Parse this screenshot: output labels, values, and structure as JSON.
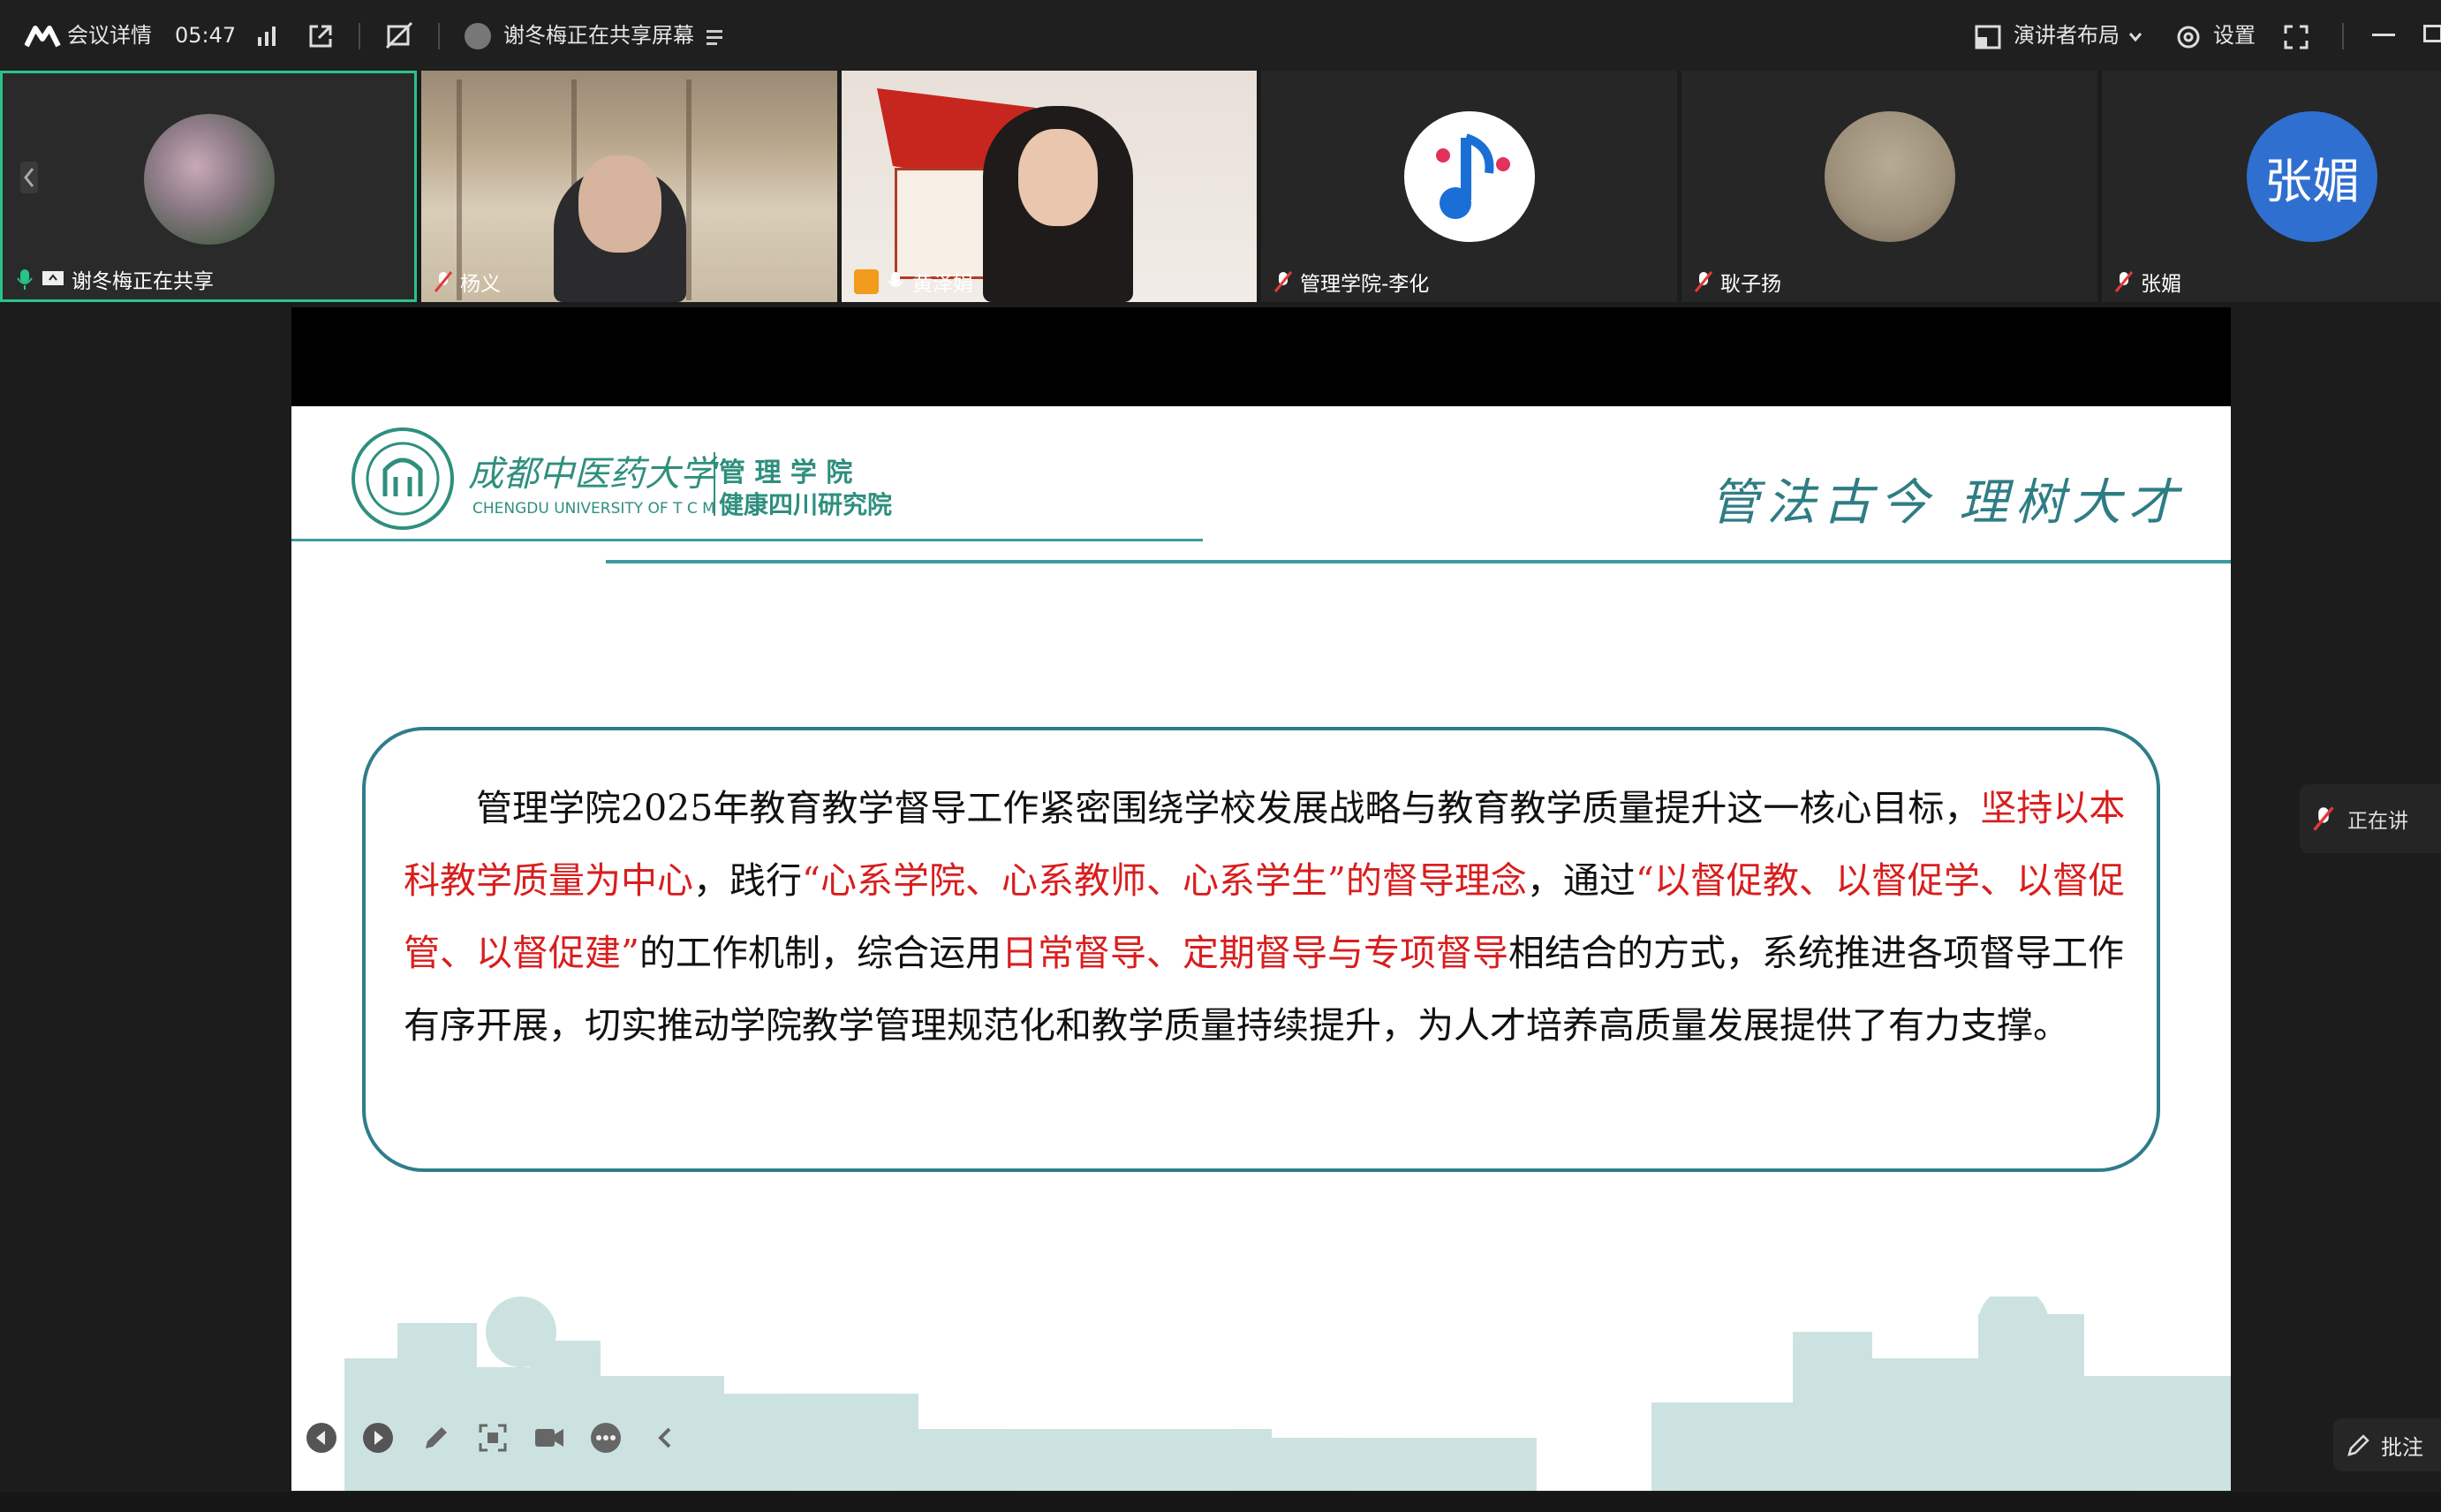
{
  "topbar": {
    "meeting_details": "会议详情",
    "timer": "05:47",
    "sharing_status": "谢冬梅正在共享屏幕",
    "layout_button": "演讲者布局",
    "settings_button": "设置"
  },
  "participants": [
    {
      "name": "谢冬梅正在共享",
      "active": true
    },
    {
      "name": "杨义"
    },
    {
      "name": "黄泽娟"
    },
    {
      "name": "管理学院-李化"
    },
    {
      "name": "耿子扬"
    },
    {
      "name": "张媚",
      "avatar_text": "张媚",
      "avatar_color": "#2f6fd0"
    }
  ],
  "slide": {
    "university_cn": "成都中医药大学",
    "university_en": "CHENGDU UNIVERSITY OF T C M",
    "college": "管 理 学 院",
    "institute": "健康四川研究院",
    "motto": "管法古今  理树大才",
    "paragraph": {
      "p1": "管理学院2025年教育教学督导工作紧密围绕学校发展战略与教育教学质量提升这一核心目标，",
      "r1": "坚持以本科教学质量为中心",
      "p2": "，践行",
      "r2": "“心系学院、心系教师、心系学生”的督导理念",
      "p3": "，通过",
      "r3": "“以督促教、以督促学、以督促管、以督促建”",
      "p4": "的工作机制，综合运用",
      "r4": "日常督导、定期督导与专项督导",
      "p5": "相结合的方式，系统推进各项督导工作有序开展，切实推动学院教学管理规范化和教学质量持续提升，为人才培养高质量发展提供了有力支撑。"
    }
  },
  "side": {
    "speaking": "正在讲",
    "annotate": "批注"
  },
  "colors": {
    "accent_green": "#28c487",
    "teal": "#2f8f9a",
    "red_text": "#d81e1e"
  }
}
